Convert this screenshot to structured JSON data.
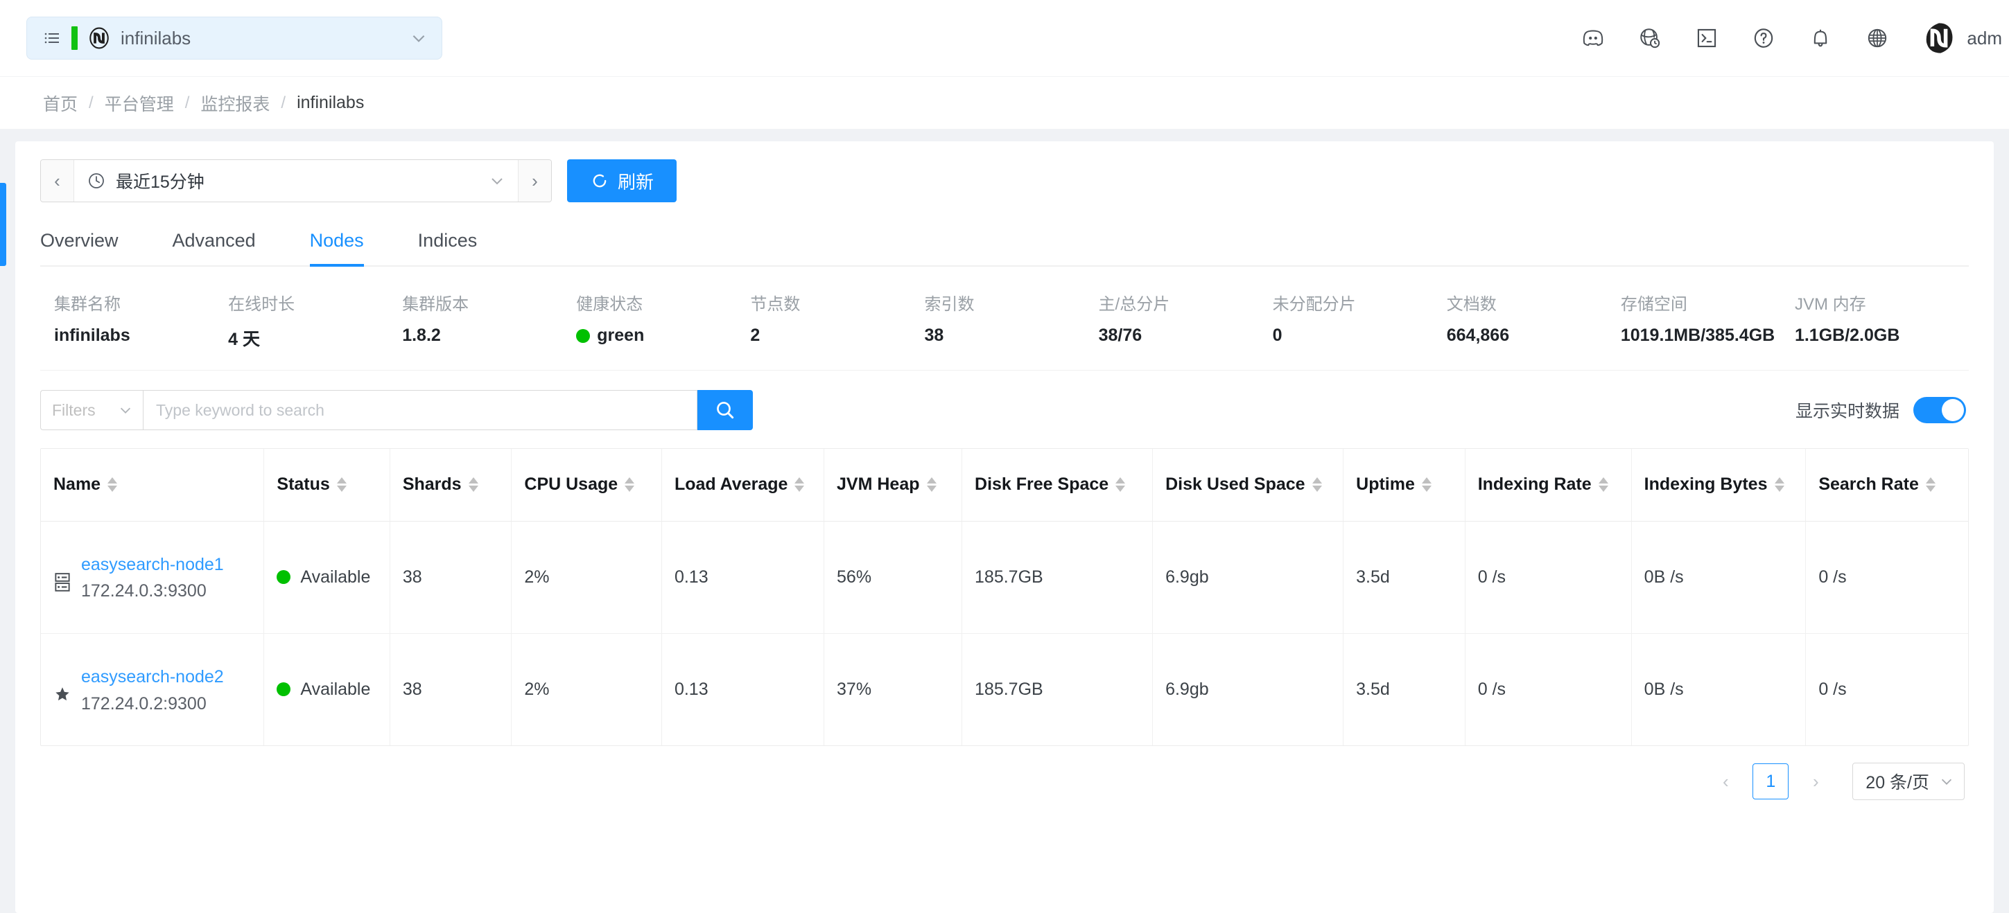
{
  "header": {
    "cluster_selector": {
      "name": "infinilabs",
      "status_color": "#12c112",
      "list_icon": "list-icon",
      "logo_icon": "infini-logo-icon",
      "chevron_icon": "chevron-down-icon"
    },
    "icons": [
      {
        "name": "discord-icon"
      },
      {
        "name": "globe-clock-icon"
      },
      {
        "name": "terminal-icon"
      },
      {
        "name": "help-circle-icon"
      },
      {
        "name": "bell-icon"
      },
      {
        "name": "language-globe-icon"
      }
    ],
    "user": "adm"
  },
  "breadcrumb": {
    "items": [
      "首页",
      "平台管理",
      "监控报表",
      "infinilabs"
    ],
    "separator": "/"
  },
  "toolbar": {
    "prev_label": "‹",
    "next_label": "›",
    "time_range": "最近15分钟",
    "clock_icon": "clock-icon",
    "chevron_icon": "chevron-down-icon",
    "refresh_label": "刷新",
    "refresh_icon": "refresh-icon",
    "refresh_color": "#1890ff"
  },
  "tabs": [
    {
      "label": "Overview",
      "active": false
    },
    {
      "label": "Advanced",
      "active": false
    },
    {
      "label": "Nodes",
      "active": true
    },
    {
      "label": "Indices",
      "active": false
    }
  ],
  "stats": [
    {
      "label": "集群名称",
      "value": "infinilabs",
      "dot": false
    },
    {
      "label": "在线时长",
      "value": "4 天",
      "dot": false
    },
    {
      "label": "集群版本",
      "value": "1.8.2",
      "dot": false
    },
    {
      "label": "健康状态",
      "value": "green",
      "dot": true,
      "dot_color": "#00c000"
    },
    {
      "label": "节点数",
      "value": "2",
      "dot": false
    },
    {
      "label": "索引数",
      "value": "38",
      "dot": false
    },
    {
      "label": "主/总分片",
      "value": "38/76",
      "dot": false
    },
    {
      "label": "未分配分片",
      "value": "0",
      "dot": false
    },
    {
      "label": "文档数",
      "value": "664,866",
      "dot": false
    },
    {
      "label": "存储空间",
      "value": "1019.1MB/385.4GB",
      "dot": false
    },
    {
      "label": "JVM 内存",
      "value": "1.1GB/2.0GB",
      "dot": false
    }
  ],
  "filters": {
    "select_label": "Filters",
    "search_placeholder": "Type keyword to search",
    "search_value": "",
    "search_icon": "search-icon",
    "realtime_label": "显示实时数据",
    "realtime_on": true
  },
  "table": {
    "columns": [
      {
        "label": "Name",
        "sortable": true
      },
      {
        "label": "Status",
        "sortable": true
      },
      {
        "label": "Shards",
        "sortable": true
      },
      {
        "label": "CPU Usage",
        "sortable": true
      },
      {
        "label": "Load Average",
        "sortable": true
      },
      {
        "label": "JVM Heap",
        "sortable": true
      },
      {
        "label": "Disk Free Space",
        "sortable": true
      },
      {
        "label": "Disk Used Space",
        "sortable": true
      },
      {
        "label": "Uptime",
        "sortable": true
      },
      {
        "label": "Indexing Rate",
        "sortable": true
      },
      {
        "label": "Indexing Bytes",
        "sortable": true
      },
      {
        "label": "Search Rate",
        "sortable": true
      }
    ],
    "rows": [
      {
        "icon": "server-rack-icon",
        "name": "easysearch-node1",
        "address": "172.24.0.3:9300",
        "status": "Available",
        "status_color": "#00c000",
        "shards": "38",
        "cpu_usage": "2%",
        "load_average": "0.13",
        "jvm_heap": "56%",
        "disk_free_space": "185.7GB",
        "disk_used_space": "6.9gb",
        "uptime": "3.5d",
        "indexing_rate": "0 /s",
        "indexing_bytes": "0B /s",
        "search_rate": "0 /s"
      },
      {
        "icon": "star-icon",
        "name": "easysearch-node2",
        "address": "172.24.0.2:9300",
        "status": "Available",
        "status_color": "#00c000",
        "shards": "38",
        "cpu_usage": "2%",
        "load_average": "0.13",
        "jvm_heap": "37%",
        "disk_free_space": "185.7GB",
        "disk_used_space": "6.9gb",
        "uptime": "3.5d",
        "indexing_rate": "0 /s",
        "indexing_bytes": "0B /s",
        "search_rate": "0 /s"
      }
    ]
  },
  "pagination": {
    "prev": "‹",
    "page": "1",
    "next": "›",
    "page_size": "20 条/页",
    "chevron_icon": "chevron-down-icon"
  }
}
